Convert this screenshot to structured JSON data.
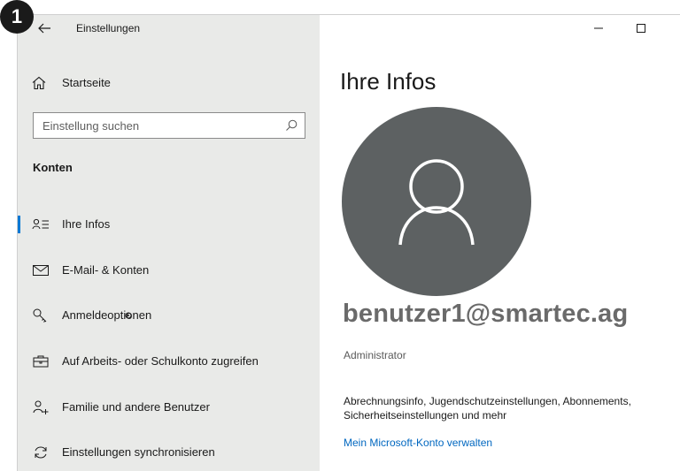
{
  "badge": {
    "number": "1"
  },
  "window": {
    "title": "Einstellungen"
  },
  "sidebar": {
    "home_label": "Startseite",
    "search": {
      "placeholder": "Einstellung suchen",
      "value": ""
    },
    "section_heading": "Konten",
    "items": [
      {
        "label": "Ihre Infos",
        "icon": "person-card-icon",
        "selected": true
      },
      {
        "label": "E-Mail- & Konten",
        "icon": "mail-icon",
        "selected": false
      },
      {
        "label": "Anmeldeoptionen",
        "icon": "key-icon",
        "selected": false
      },
      {
        "label": "Auf Arbeits- oder Schulkonto zugreifen",
        "icon": "briefcase-icon",
        "selected": false
      },
      {
        "label": "Familie und andere Benutzer",
        "icon": "person-add-icon",
        "selected": false
      },
      {
        "label": "Einstellungen synchronisieren",
        "icon": "sync-icon",
        "selected": false
      }
    ]
  },
  "main": {
    "title": "Ihre Infos",
    "account_name": "benutzer1@smartec.ag",
    "account_role": "Administrator",
    "description": "Abrechnungsinfo, Jugendschutzeinstellungen, Abonnements, Sicherheitseinstellungen und mehr",
    "link_label": "Mein Microsoft-Konto verwalten"
  },
  "colors": {
    "sidebar_bg": "#e9eae8",
    "accent": "#0078d4",
    "link": "#0067c0",
    "avatar_bg": "#5d6162"
  }
}
